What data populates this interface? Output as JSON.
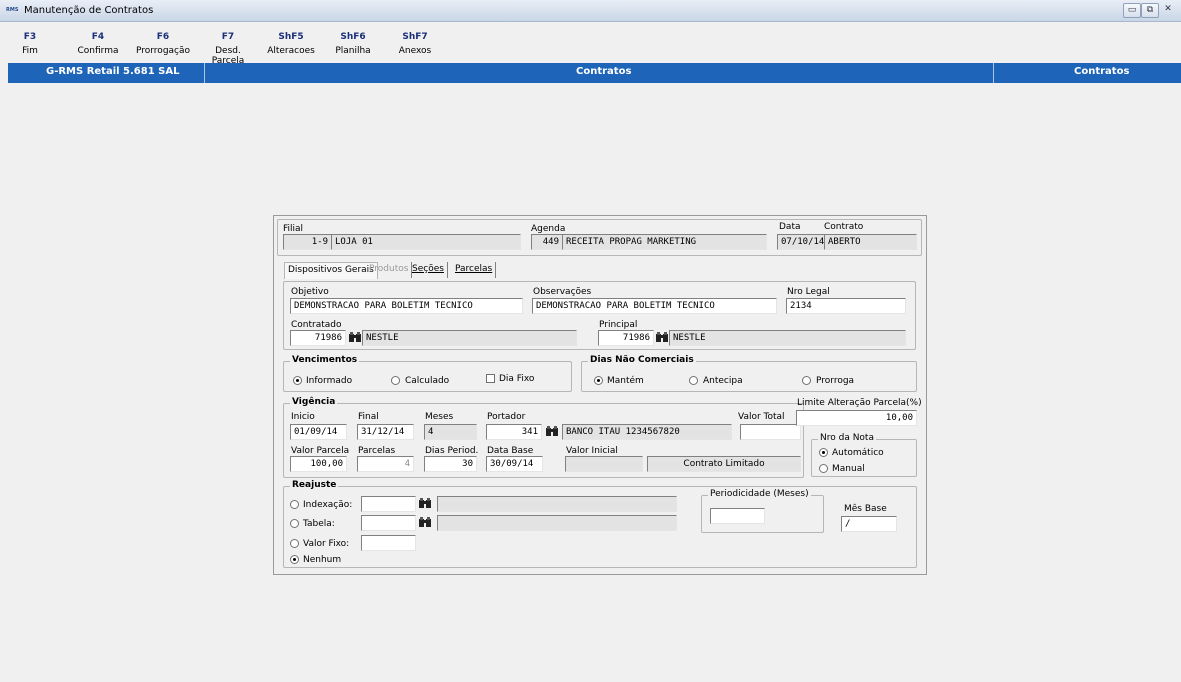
{
  "window": {
    "logo_text": "RMS",
    "title": "Manutenção de Contratos",
    "controls": [
      "▭",
      "⧉",
      "✕"
    ]
  },
  "toolbar": [
    {
      "key": "F3",
      "label": "Fim"
    },
    {
      "key": "F4",
      "label": "Confirma"
    },
    {
      "key": "F6",
      "label": "Prorrogação"
    },
    {
      "key": "F7",
      "label": "Desd. Parcela"
    },
    {
      "key": "ShF5",
      "label": "Alteracoes"
    },
    {
      "key": "ShF6",
      "label": "Planilha"
    },
    {
      "key": "ShF7",
      "label": "Anexos"
    }
  ],
  "statusbar": {
    "product": "G-RMS Retail 5.681 SAL",
    "center": "Contratos",
    "right": "Contratos",
    "color": "#1e64b8"
  },
  "header": {
    "filial_label": "Filial",
    "filial_code": "1-9",
    "filial_name": "LOJA 01",
    "agenda_label": "Agenda",
    "agenda_code": "449",
    "agenda_name": "RECEITA PROPAG MARKETING",
    "data_label": "Data",
    "data_value": "07/10/14",
    "contrato_label": "Contrato",
    "contrato_value": "ABERTO"
  },
  "tabs": [
    {
      "label": "Dispositivos Gerais",
      "state": "active"
    },
    {
      "label": "Produtos",
      "state": "disabled"
    },
    {
      "label": "Seções",
      "state": "normal"
    },
    {
      "label": "Parcelas",
      "state": "normal"
    }
  ],
  "geral": {
    "objetivo_label": "Objetivo",
    "objetivo": "DEMONSTRACAO PARA BOLETIM TECNICO",
    "observacoes_label": "Observações",
    "observacoes": "DEMONSTRACAO PARA BOLETIM TECNICO",
    "nro_legal_label": "Nro Legal",
    "nro_legal": "2134",
    "contratado_label": "Contratado",
    "contratado_code": "71986",
    "contratado_name": "NESTLE",
    "principal_label": "Principal",
    "principal_code": "71986",
    "principal_name": "NESTLE"
  },
  "vencimentos": {
    "title": "Vencimentos",
    "informado": "Informado",
    "calculado": "Calculado",
    "dia_fixo": "Dia Fixo",
    "selected": "informado"
  },
  "dias_nao_comerciais": {
    "title": "Dias Não Comerciais",
    "mantem": "Mantém",
    "antecipa": "Antecipa",
    "prorroga": "Prorroga",
    "selected": "mantem"
  },
  "vigencia": {
    "title": "Vigência",
    "inicio_label": "Inicio",
    "inicio": "01/09/14",
    "final_label": "Final",
    "final": "31/12/14",
    "meses_label": "Meses",
    "meses": "4",
    "portador_label": "Portador",
    "portador_code": "341",
    "portador_name": "BANCO ITAU 1234567820",
    "valor_total_label": "Valor Total",
    "valor_total": "",
    "valor_parcela_label": "Valor Parcela",
    "valor_parcela": "100,00",
    "parcelas_label": "Parcelas",
    "parcelas": "4",
    "dias_period_label": "Dias Period.",
    "dias_period": "30",
    "data_base_label": "Data Base",
    "data_base": "30/09/14",
    "valor_inicial_label": "Valor Inicial",
    "valor_inicial": "",
    "contrato_limitado": "Contrato Limitado"
  },
  "limite": {
    "label": "Limite Alteração Parcela(%)",
    "value": "10,00"
  },
  "nro_nota": {
    "title": "Nro da Nota",
    "automatico": "Automático",
    "manual": "Manual",
    "selected": "automatico"
  },
  "reajuste": {
    "title": "Reajuste",
    "indexacao": "Indexação:",
    "tabela": "Tabela:",
    "valor_fixo": "Valor Fixo:",
    "nenhum": "Nenhum",
    "selected": "nenhum",
    "periodicidade_label": "Periodicidade (Meses)",
    "periodicidade": "",
    "mes_base_label": "Mês Base",
    "mes_base": "/"
  }
}
